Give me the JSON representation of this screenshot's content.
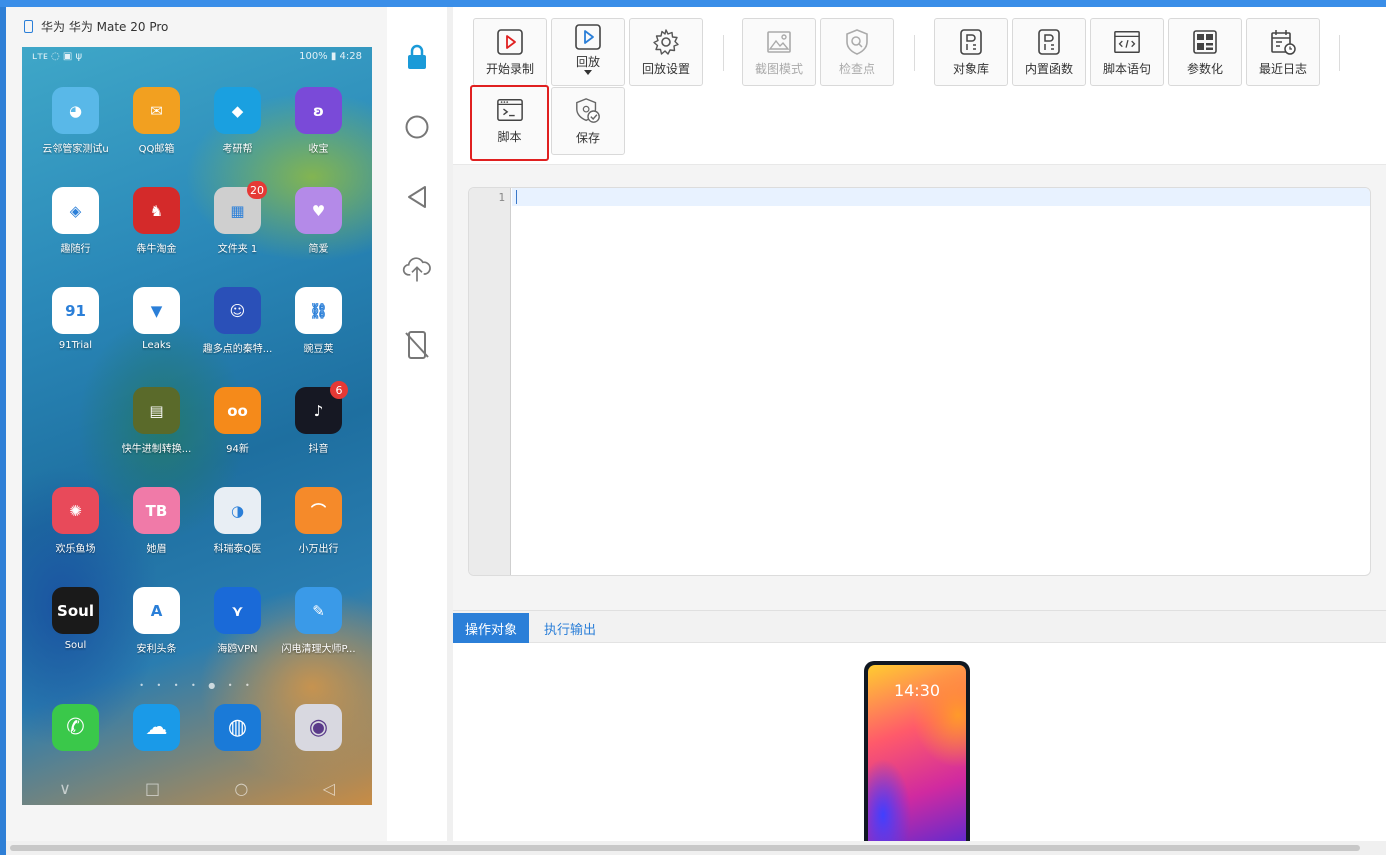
{
  "device": {
    "title": "华为 华为 Mate 20 Pro",
    "status_left": "ʟᴛᴇ ◌ ▣ ψ",
    "status_right": "100% ▮ 4:28",
    "apps": [
      {
        "label": "云邻管家测试u",
        "color": "#59b8e8",
        "glyph": "◕"
      },
      {
        "label": "QQ邮箱",
        "color": "#f2a020",
        "glyph": "✉"
      },
      {
        "label": "考研帮",
        "color": "#1aa0e0",
        "glyph": "◆"
      },
      {
        "label": "收宝",
        "color": "#7a4ad8",
        "glyph": "ʚ"
      },
      {
        "label": "趣随行",
        "color": "#ffffff",
        "glyph": "◈"
      },
      {
        "label": "犇牛淘金",
        "color": "#d42a2a",
        "glyph": "♞"
      },
      {
        "label": "文件夹 1",
        "color": "#cfcfcf",
        "glyph": "▦",
        "badge": "20"
      },
      {
        "label": "简爱",
        "color": "#b48ae8",
        "glyph": "♥"
      },
      {
        "label": "91Trial",
        "color": "#ffffff",
        "glyph": "91"
      },
      {
        "label": "Leaks",
        "color": "#ffffff",
        "glyph": "▼"
      },
      {
        "label": "趣多点的秦特...",
        "color": "#2a50b8",
        "glyph": "☺"
      },
      {
        "label": "豌豆荚",
        "color": "#ffffff",
        "glyph": "⛓"
      },
      {
        "label": "快牛进制转换...",
        "color": "#5a6a2a",
        "glyph": "▤"
      },
      {
        "label": "94新",
        "color": "#f58a1a",
        "glyph": "oo"
      },
      {
        "label": "抖音",
        "color": "#161823",
        "glyph": "♪",
        "badge": "6"
      },
      {
        "label": "欢乐鱼场",
        "color": "#e84a5a",
        "glyph": "✺"
      },
      {
        "label": "她眉",
        "color": "#f07aa8",
        "glyph": "TB"
      },
      {
        "label": "科瑞泰Q医",
        "color": "#e8eef4",
        "glyph": "◑"
      },
      {
        "label": "小万出行",
        "color": "#f58a2a",
        "glyph": "⌒"
      },
      {
        "label": "Soul",
        "color": "#1a1a1a",
        "glyph": "Soul"
      },
      {
        "label": "安利头条",
        "color": "#ffffff",
        "glyph": "A"
      },
      {
        "label": "海鸥VPN",
        "color": "#1a6ad8",
        "glyph": "⋎"
      },
      {
        "label": "闪电清理大师P...",
        "color": "#3a9ae8",
        "glyph": "✎"
      }
    ],
    "dock": [
      {
        "name": "phone-app",
        "color": "#3ac84a",
        "glyph": "✆"
      },
      {
        "name": "messages-app",
        "color": "#1a9ae8",
        "glyph": "☁"
      },
      {
        "name": "browser-app",
        "color": "#1a7ad8",
        "glyph": "◍"
      },
      {
        "name": "camera-app",
        "color": "#d8d8e0",
        "glyph": "◉"
      }
    ],
    "page_dots": "• • • • ● • •",
    "nav": [
      "∨",
      "□",
      "○",
      "◁"
    ]
  },
  "toolbar": {
    "start_record": "开始录制",
    "replay": "回放",
    "replay_settings": "回放设置",
    "screenshot_mode": "截图模式",
    "checkpoint": "检查点",
    "object_library": "对象库",
    "builtin_functions": "内置函数",
    "script_statements": "脚本语句",
    "parameterize": "参数化",
    "recent_logs": "最近日志",
    "script": "脚本",
    "save": "保存"
  },
  "editor": {
    "line_numbers": [
      "1"
    ]
  },
  "bottom": {
    "tab_objects": "操作对象",
    "tab_output": "执行输出",
    "preview_time": "14:30"
  },
  "colors": {
    "accent": "#2b7fd8",
    "highlight": "#e02020"
  }
}
